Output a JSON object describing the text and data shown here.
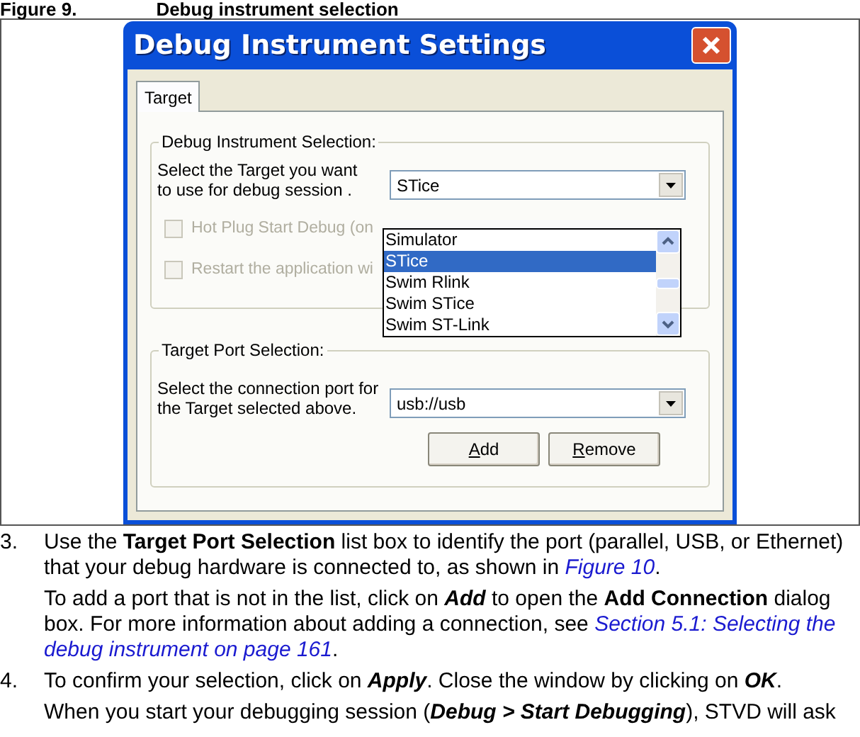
{
  "caption": {
    "number": "Figure 9.",
    "title": "Debug instrument selection"
  },
  "dialog": {
    "title": "Debug Instrument Settings",
    "tabs": [
      {
        "label": "Target",
        "selected": true
      }
    ],
    "instrument_group": {
      "title": "Debug Instrument Selection:",
      "prompt": [
        "Select the Target you want",
        "to use for debug session ."
      ],
      "combo_value": "STice",
      "dropdown": [
        {
          "label": "Simulator",
          "selected": false
        },
        {
          "label": "STice",
          "selected": true
        },
        {
          "label": "Swim Rlink",
          "selected": false
        },
        {
          "label": "Swim STice",
          "selected": false
        },
        {
          "label": "Swim ST-Link",
          "selected": false
        }
      ],
      "checkboxes": [
        {
          "label": "Hot Plug Start Debug (on",
          "checked": false,
          "disabled": true
        },
        {
          "label": "Restart the application wi",
          "checked": false,
          "disabled": true
        }
      ]
    },
    "port_group": {
      "title": "Target Port Selection:",
      "prompt": [
        "Select the connection port for",
        "the Target selected above."
      ],
      "combo_value": "usb://usb",
      "buttons": [
        {
          "accel": "A",
          "rest": "dd"
        },
        {
          "accel": "R",
          "rest": "emove"
        }
      ]
    }
  },
  "steps": [
    {
      "number": "3.",
      "paragraphs": [
        [
          {
            "kind": "plain",
            "text": "Use the "
          },
          {
            "kind": "bold",
            "text": "Target Port Selection"
          },
          {
            "kind": "plain",
            "text": " list box to identify the port (parallel, USB, or Ethernet) that your debug hardware is connected to, as shown in "
          },
          {
            "kind": "link",
            "text": "Figure 10"
          },
          {
            "kind": "plain",
            "text": "."
          }
        ],
        [
          {
            "kind": "plain",
            "text": "To add a port that is not in the list, click on "
          },
          {
            "kind": "bolditalic",
            "text": "Add"
          },
          {
            "kind": "plain",
            "text": " to open the "
          },
          {
            "kind": "bold",
            "text": "Add Connection"
          },
          {
            "kind": "plain",
            "text": " dialog box. For more information about adding a connection, see "
          },
          {
            "kind": "wrapped_link",
            "lines": [
              "Section 5.1: Selecting the",
              "debug instrument on page 161"
            ]
          },
          {
            "kind": "plain",
            "text": "."
          }
        ]
      ]
    },
    {
      "number": "4.",
      "paragraphs": [
        [
          {
            "kind": "plain",
            "text": "To confirm your selection, click on "
          },
          {
            "kind": "bolditalic",
            "text": "Apply"
          },
          {
            "kind": "plain",
            "text": ". Close the window by clicking on "
          },
          {
            "kind": "bolditalic",
            "text": "OK"
          },
          {
            "kind": "plain",
            "text": "."
          }
        ],
        [
          {
            "kind": "plain",
            "text": "When you start your debugging session ("
          },
          {
            "kind": "bolditalic",
            "text": "Debug > Start Debugging"
          },
          {
            "kind": "plain",
            "text": "), STVD will ask"
          }
        ]
      ]
    }
  ]
}
